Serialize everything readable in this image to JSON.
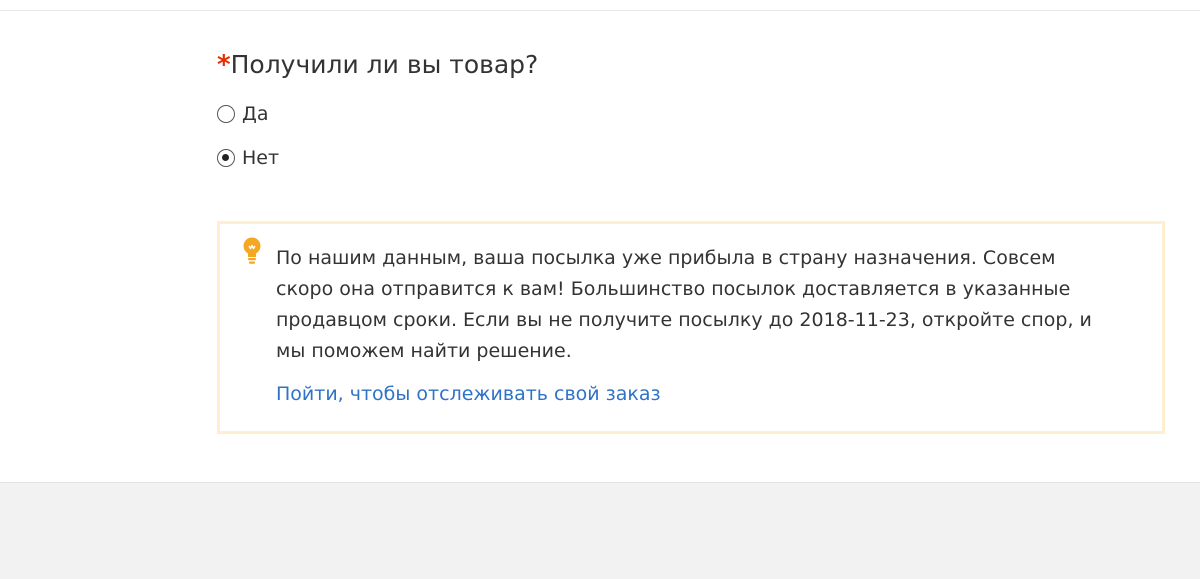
{
  "question": {
    "required_mark": "*",
    "text": "Получили ли вы товар?"
  },
  "options": [
    {
      "label": "Да",
      "checked": false
    },
    {
      "label": "Нет",
      "checked": true
    }
  ],
  "notice": {
    "icon": "lightbulb-icon",
    "text": "По нашим данным, ваша посылка уже прибыла в страну назначения. Совсем скоро она отправится к вам! Большинство посылок доставляется в указанные продавцом сроки. Если вы не получите посылку до 2018-11-23, откройте спор, и мы поможем найти решение.",
    "link_label": "Пойти, чтобы отслеживать свой заказ"
  },
  "colors": {
    "required": "#e62e04",
    "link": "#2f73c6",
    "notice_border": "#fdefcf",
    "bulb": "#f5a623"
  }
}
